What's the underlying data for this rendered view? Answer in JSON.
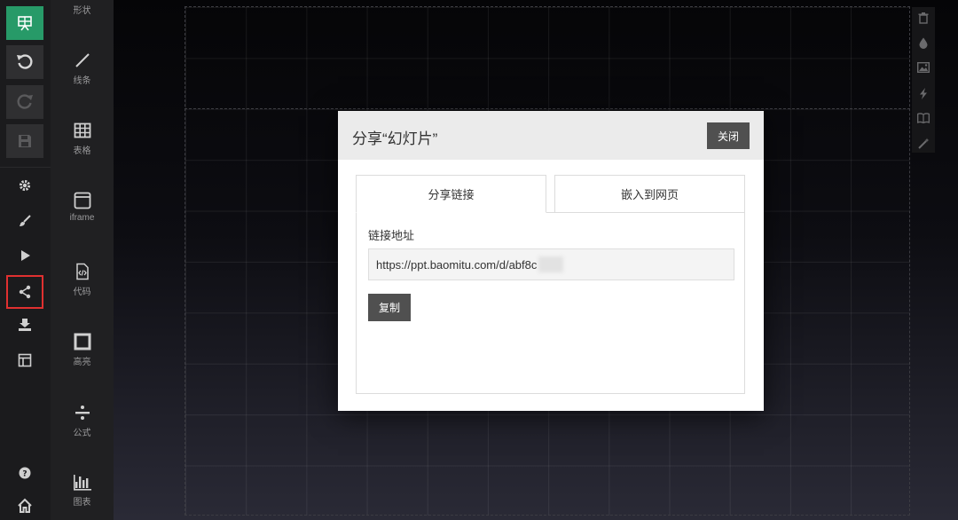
{
  "modal": {
    "title": "分享“幻灯片”",
    "close_label": "关闭",
    "tabs": [
      {
        "label": "分享链接",
        "active": true
      },
      {
        "label": "嵌入到网页",
        "active": false
      }
    ],
    "link_label": "链接地址",
    "url_value": "https://ppt.baomitu.com/d/abf8c",
    "copy_label": "复制"
  },
  "toolbar": {
    "items": [
      {
        "icon": "presentation-icon",
        "state": "active"
      },
      {
        "icon": "undo-icon"
      },
      {
        "icon": "redo-icon",
        "state": "disabled"
      },
      {
        "icon": "save-icon",
        "state": "disabled"
      },
      {
        "icon": "gear-icon"
      },
      {
        "icon": "brush-icon"
      },
      {
        "icon": "play-icon"
      },
      {
        "icon": "share-icon",
        "state": "selected"
      },
      {
        "icon": "download-icon"
      },
      {
        "icon": "layout-icon"
      },
      {
        "icon": "help-icon"
      },
      {
        "icon": "home-icon"
      }
    ]
  },
  "components": [
    {
      "label": "形状",
      "icon": "shape-icon"
    },
    {
      "label": "线条",
      "icon": "line-icon"
    },
    {
      "label": "表格",
      "icon": "table-icon"
    },
    {
      "label": "iframe",
      "icon": "iframe-icon"
    },
    {
      "label": "代码",
      "icon": "code-icon"
    },
    {
      "label": "高亮",
      "icon": "highlight-icon"
    },
    {
      "label": "公式",
      "icon": "formula-icon"
    },
    {
      "label": "图表",
      "icon": "chart-icon"
    }
  ],
  "right_tools": [
    "trash-icon",
    "drop-icon",
    "image-icon",
    "lightning-icon",
    "book-icon",
    "magic-wand-icon"
  ],
  "colors": {
    "accent_green": "#279a68",
    "button_dark": "#505050",
    "selected_outline": "#e03030"
  }
}
